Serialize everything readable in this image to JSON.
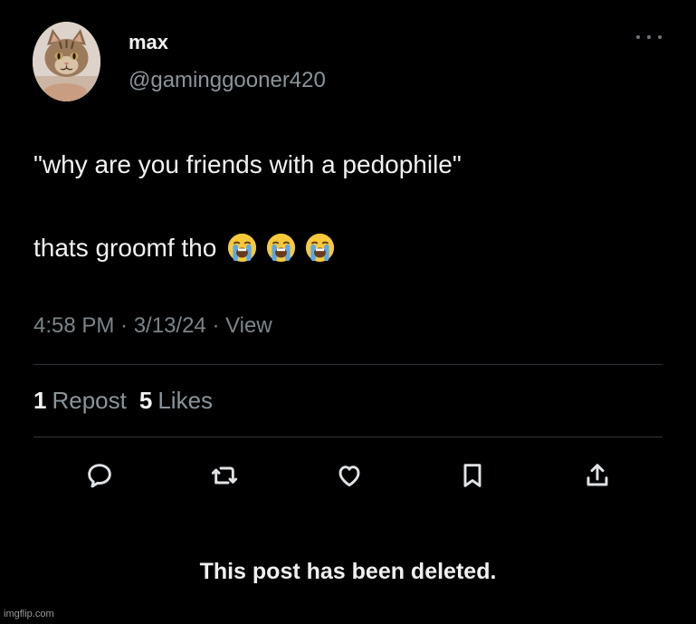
{
  "author": {
    "display_name": "max",
    "handle": "@gaminggooner420",
    "avatar_icon": "cat-avatar"
  },
  "tweet": {
    "line1": "\"why are you friends with a pedophile\"",
    "line2_text": "thats groomf tho",
    "emojis": [
      "loudly-crying-face",
      "loudly-crying-face",
      "loudly-crying-face"
    ]
  },
  "meta": {
    "time_line": "4:58 PM · 3/13/24 · View"
  },
  "stats": {
    "reposts_count": "1",
    "reposts_label": "Repost",
    "likes_count": "5",
    "likes_label": "Likes"
  },
  "actions": [
    "reply-icon",
    "repost-icon",
    "like-icon",
    "bookmark-icon",
    "share-icon"
  ],
  "deleted_notice": "This post has been deleted.",
  "watermark": "imgflip.com",
  "colors": {
    "background": "#000000",
    "text_primary": "#f2f2f2",
    "text_secondary": "#8b949a",
    "divider": "#2f3336"
  }
}
